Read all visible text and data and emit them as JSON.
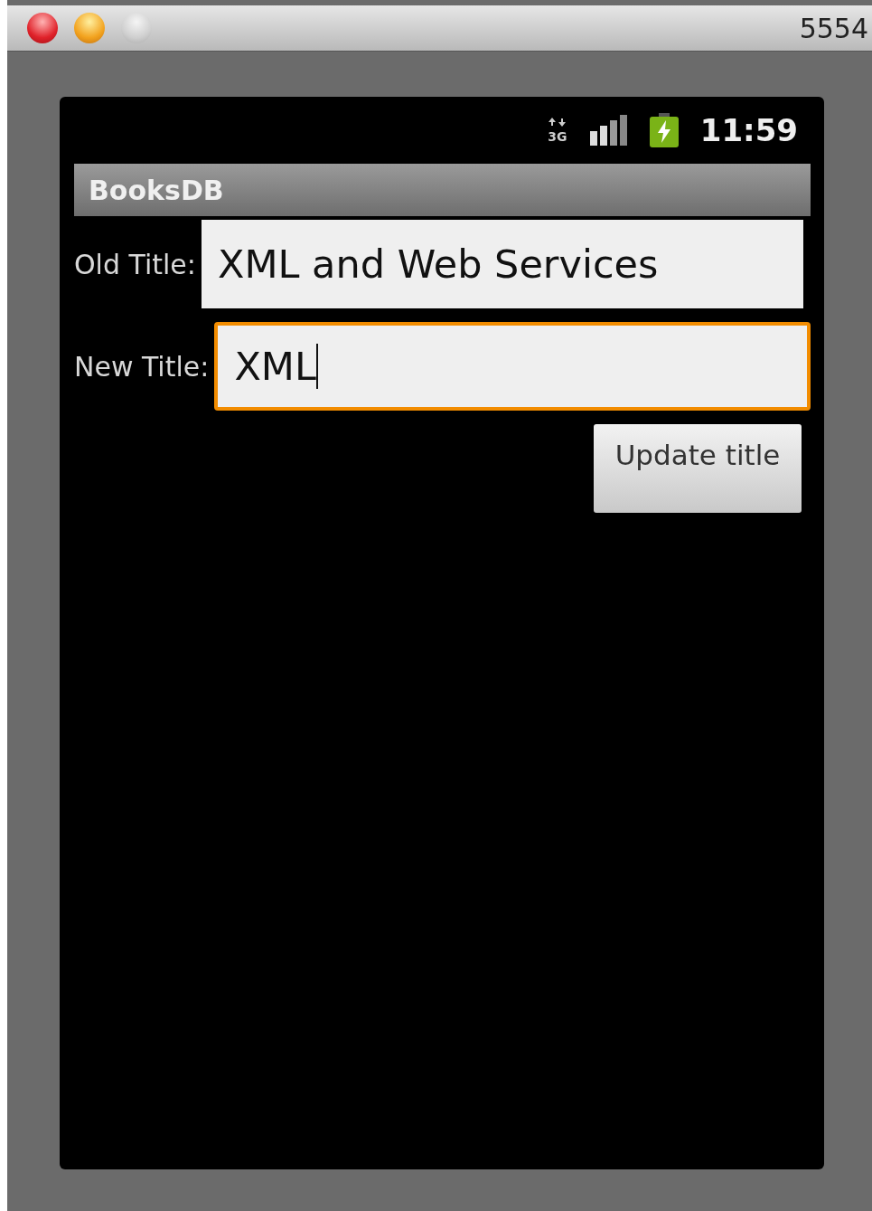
{
  "window": {
    "title": "5554"
  },
  "status_bar": {
    "network": "3G",
    "time": "11:59"
  },
  "app_bar": {
    "title": "BooksDB"
  },
  "fields": [
    {
      "label": "Old Title:",
      "value": "XML and Web Services",
      "focused": false
    },
    {
      "label": "New Title:",
      "value": "XML",
      "focused": true
    }
  ],
  "buttons": [
    "Update title"
  ]
}
